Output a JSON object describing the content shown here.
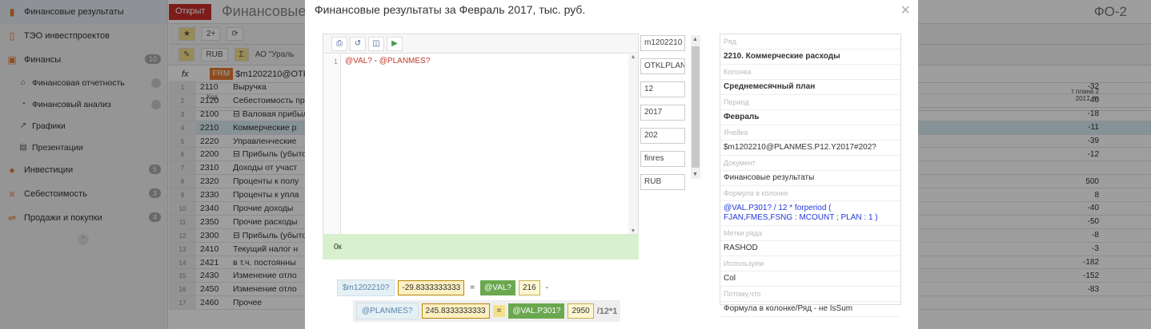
{
  "sidebar": {
    "items": [
      {
        "label": "Финансовые результаты",
        "icon": "bookmark-icon",
        "active": true
      },
      {
        "label": "ТЭО инвестпроектов",
        "icon": "bookmark-outline-icon"
      },
      {
        "label": "Финансы",
        "icon": "money-icon",
        "badge": "10"
      },
      {
        "label": "Финансовая отчетность",
        "icon": "bank-icon",
        "badge": "",
        "sub": true
      },
      {
        "label": "Финансовый анализ",
        "icon": "pie-icon",
        "badge": "",
        "sub": true
      },
      {
        "label": "Графики",
        "icon": "chart-icon",
        "sub": true
      },
      {
        "label": "Презентации",
        "icon": "presentation-icon",
        "sub": true
      },
      {
        "label": "Инвестиции",
        "icon": "coins-icon",
        "badge": "5"
      },
      {
        "label": "Себестоимость",
        "icon": "database-icon",
        "badge": "3"
      },
      {
        "label": "Продажи и покупки",
        "icon": "handshake-icon",
        "badge": "4"
      }
    ]
  },
  "main": {
    "tab_status": "Открыт",
    "tab_title": "Финансовые",
    "form_code": "ФО-2",
    "toolbar": {
      "b1": "★",
      "b2": "2+",
      "b3": "⟳",
      "b4": "RUB",
      "b5": "Σ",
      "org": "АО \"Ураль"
    },
    "fx": {
      "label": "fx",
      "frm": "FRM",
      "formula": "$m1202210@OTKL"
    },
    "col_code": "Код",
    "col_last": "т плана 2 2017, %",
    "rows": [
      {
        "n": "1",
        "code": "2110",
        "name": "Выручка",
        "val": "-32"
      },
      {
        "n": "2",
        "code": "2120",
        "name": "Себестоимость про",
        "val": "-40"
      },
      {
        "n": "3",
        "code": "2100",
        "name": "⊟ Валовая прибыль",
        "val": "-18"
      },
      {
        "n": "4",
        "code": "2210",
        "name": "Коммерческие р",
        "val": "-11"
      },
      {
        "n": "5",
        "code": "2220",
        "name": "Управленческие",
        "val": "-39"
      },
      {
        "n": "6",
        "code": "2200",
        "name": "⊟ Прибыль (убыток",
        "val": "-12"
      },
      {
        "n": "7",
        "code": "2310",
        "name": "Доходы от участ",
        "val": ""
      },
      {
        "n": "8",
        "code": "2320",
        "name": "Проценты к полу",
        "val": "500"
      },
      {
        "n": "9",
        "code": "2330",
        "name": "Проценты к упла",
        "val": "8"
      },
      {
        "n": "10",
        "code": "2340",
        "name": "Прочие доходы",
        "val": "-40"
      },
      {
        "n": "11",
        "code": "2350",
        "name": "Прочие расходы",
        "val": "-50"
      },
      {
        "n": "12",
        "code": "2300",
        "name": "⊟ Прибыль (убыток",
        "val": "-8"
      },
      {
        "n": "13",
        "code": "2410",
        "name": "Текущий налог н",
        "val": "-3"
      },
      {
        "n": "14",
        "code": "2421",
        "name": "в т.ч. постоянны",
        "val": "-182"
      },
      {
        "n": "15",
        "code": "2430",
        "name": "Изменение отло",
        "val": "-152"
      },
      {
        "n": "16",
        "code": "2450",
        "name": "Изменение отло",
        "val": "-83"
      },
      {
        "n": "17",
        "code": "2460",
        "name": "Прочее",
        "val": ""
      }
    ]
  },
  "modal": {
    "title": "Финансовые результаты за Февраль 2017, тыс. руб.",
    "close": "×",
    "editor": {
      "line": "1",
      "code_a": "@VAL?",
      "code_sep": " - ",
      "code_b": "@PLANMES?"
    },
    "result": "0к",
    "params": [
      "m1202210",
      "OTKLPLAN",
      "12",
      "2017",
      "202",
      "finres",
      "RUB"
    ],
    "info": [
      {
        "label": "Ряд",
        "value": "2210. Коммерческие расходы",
        "bold": true
      },
      {
        "label": "Колонка",
        "value": "Среднемесячный план",
        "bold": true
      },
      {
        "label": "Период",
        "value": "Февраль",
        "bold": true
      },
      {
        "label": "Ячейка",
        "value": "$m1202210@PLANMES.P12.Y2017#202?"
      },
      {
        "label": "Документ",
        "value": "Финансовые результаты"
      },
      {
        "label": "Формула в колонке",
        "value": "@VAL.P301? / 12 * forperiod ( FJAN,FMES,FSNG : MCOUNT ; PLAN : 1 )",
        "blue": true
      },
      {
        "label": "Метки ряда",
        "value": "RASHOD"
      },
      {
        "label": "Используем",
        "value": "Col"
      },
      {
        "label": "Потому,что",
        "value": "Формула в колонке/Ряд - не IsSum"
      }
    ],
    "trace": {
      "ref1": "$m1202210?",
      "num1": "-29.8333333333",
      "eq": "=",
      "gref1": "@VAL?",
      "gnum1": "216",
      "op1": "-",
      "ref2": "@PLANMES?",
      "num2": "245.8333333333",
      "op2": "=",
      "gref2": "@VAL.P301?",
      "gnum2": "2950",
      "tail": "/12*1"
    }
  }
}
